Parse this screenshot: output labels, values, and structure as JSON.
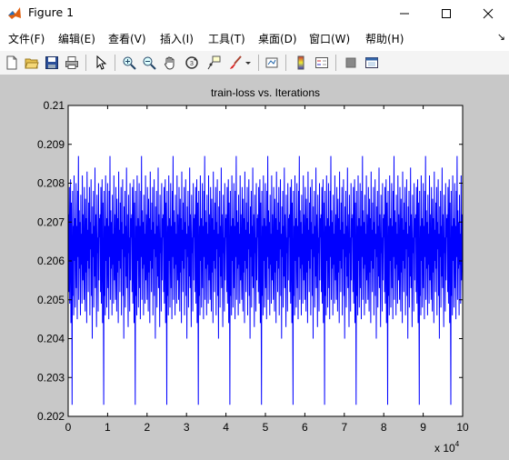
{
  "window": {
    "title": "Figure 1"
  },
  "menu": [
    {
      "label": "文件(F)"
    },
    {
      "label": "编辑(E)"
    },
    {
      "label": "查看(V)"
    },
    {
      "label": "插入(I)"
    },
    {
      "label": "工具(T)"
    },
    {
      "label": "桌面(D)"
    },
    {
      "label": "窗口(W)"
    },
    {
      "label": "帮助(H)"
    }
  ],
  "toolbar": {
    "icons": [
      "new-figure-icon",
      "open-file-icon",
      "save-icon",
      "print-icon",
      "edit-plot-arrow-icon",
      "zoom-in-icon",
      "zoom-out-icon",
      "pan-hand-icon",
      "rotate-3d-icon",
      "data-cursor-icon",
      "brush-icon",
      "link-plot-icon",
      "colorbar-icon",
      "legend-icon",
      "hide-plot-tools-icon",
      "show-plot-tools-icon"
    ]
  },
  "chart_data": {
    "type": "line",
    "title": "train-loss vs. Iterations",
    "xlabel": "",
    "ylabel": "",
    "xlim": [
      0,
      100000
    ],
    "ylim": [
      0.202,
      0.21
    ],
    "x_multiplier_label": "x 10",
    "x_multiplier_exp": "4",
    "xticks": [
      0,
      10000,
      20000,
      30000,
      40000,
      50000,
      60000,
      70000,
      80000,
      90000,
      100000
    ],
    "xtick_labels": [
      "0",
      "1",
      "2",
      "3",
      "4",
      "5",
      "6",
      "7",
      "8",
      "9",
      "10"
    ],
    "yticks": [
      0.202,
      0.203,
      0.204,
      0.205,
      0.206,
      0.207,
      0.208,
      0.209,
      0.21
    ],
    "ytick_labels": [
      "0.202",
      "0.203",
      "0.204",
      "0.205",
      "0.206",
      "0.207",
      "0.208",
      "0.209",
      "0.21"
    ],
    "grid": false,
    "series": [
      {
        "color": "#0000ff",
        "pattern_period": 8000,
        "pattern": {
          "x": [
            0,
            100,
            200,
            300,
            400,
            500,
            600,
            700,
            800,
            900,
            1000,
            1100,
            1200,
            1300,
            1400,
            1500,
            1600,
            1700,
            1800,
            1900,
            2000,
            2100,
            2200,
            2300,
            2400,
            2500,
            2600,
            2700,
            2800,
            2900,
            3000,
            3100,
            3200,
            3300,
            3400,
            3500,
            3600,
            3700,
            3800,
            3900,
            4000,
            4100,
            4200,
            4300,
            4400,
            4500,
            4600,
            4700,
            4800,
            4900,
            5000,
            5100,
            5200,
            5300,
            5400,
            5500,
            5600,
            5700,
            5800,
            5900,
            6000,
            6100,
            6200,
            6300,
            6400,
            6500,
            6600,
            6700,
            6800,
            6900,
            7000,
            7100,
            7200,
            7300,
            7400,
            7500,
            7600,
            7700,
            7800,
            7900
          ],
          "y": [
            0.2066,
            0.2072,
            0.2052,
            0.2079,
            0.2049,
            0.2064,
            0.2081,
            0.2044,
            0.2075,
            0.2057,
            0.2023,
            0.2078,
            0.2051,
            0.2069,
            0.2046,
            0.2082,
            0.206,
            0.2071,
            0.2048,
            0.2065,
            0.208,
            0.2053,
            0.2069,
            0.2045,
            0.2078,
            0.2061,
            0.2087,
            0.205,
            0.2073,
            0.2058,
            0.207,
            0.2046,
            0.2077,
            0.2059,
            0.2067,
            0.2049,
            0.2082,
            0.2055,
            0.2072,
            0.2062,
            0.205,
            0.2079,
            0.2063,
            0.2047,
            0.2076,
            0.2057,
            0.2071,
            0.2044,
            0.2083,
            0.206,
            0.2068,
            0.2052,
            0.2075,
            0.2058,
            0.2079,
            0.2046,
            0.207,
            0.2063,
            0.2081,
            0.2051,
            0.2067,
            0.204,
            0.2074,
            0.2061,
            0.2078,
            0.2048,
            0.2069,
            0.2056,
            0.2084,
            0.2053,
            0.2072,
            0.2058,
            0.2043,
            0.2077,
            0.2062,
            0.2066,
            0.2047,
            0.208,
            0.2055,
            0.2071
          ]
        }
      }
    ]
  }
}
